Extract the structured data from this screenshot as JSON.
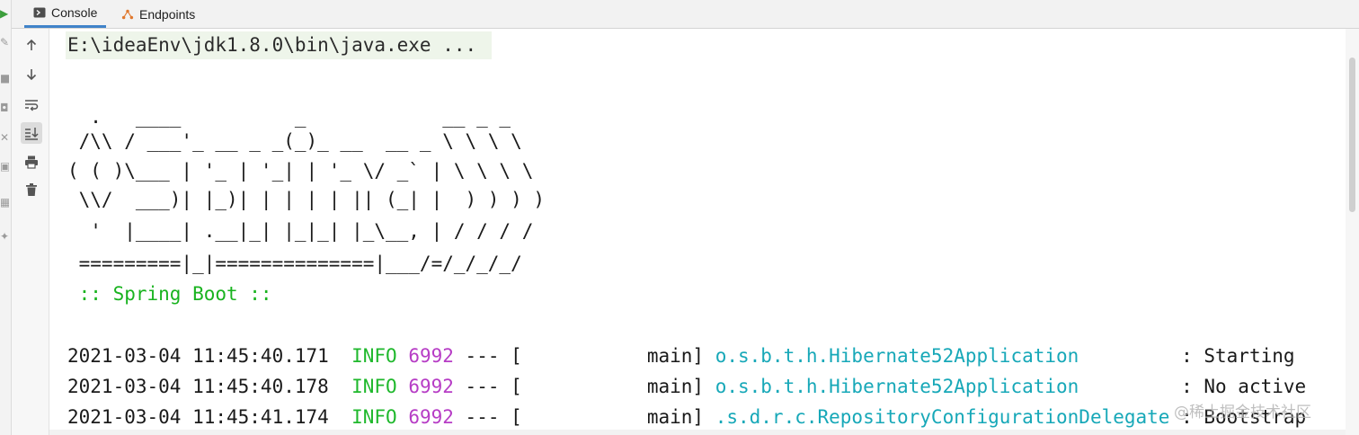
{
  "tabs": [
    {
      "label": "Console",
      "icon": "console-icon",
      "active": true
    },
    {
      "label": "Endpoints",
      "icon": "endpoints-icon",
      "active": false
    }
  ],
  "toolbar": {
    "buttons": [
      "up-arrow-icon",
      "down-arrow-icon",
      "soft-wrap-icon",
      "scroll-to-end-icon",
      "print-icon",
      "trash-icon"
    ]
  },
  "console": {
    "command": "E:\\ideaEnv\\jdk1.8.0\\bin\\java.exe ...",
    "banner": [
      "  .   ____          _            __ _ _",
      " /\\\\ / ___'_ __ _ _(_)_ __  __ _ \\ \\ \\ \\",
      "( ( )\\___ | '_ | '_| | '_ \\/ _` | \\ \\ \\ \\",
      " \\\\/  ___)| |_)| | | | | || (_| |  ) ) ) )",
      "  '  |____| .__|_| |_|_| |_\\__, | / / / /",
      " =========|_|==============|___/=/_/_/_/"
    ],
    "spring_label": " :: Spring Boot :: ",
    "logs": [
      {
        "timestamp": "2021-03-04 11:45:40.171",
        "level": "INFO",
        "pid": "6992",
        "sep": " --- [",
        "thread": "           main]",
        "logger": "o.s.b.t.h.Hibernate52Application",
        "message": "         : Starting"
      },
      {
        "timestamp": "2021-03-04 11:45:40.178",
        "level": "INFO",
        "pid": "6992",
        "sep": " --- [",
        "thread": "           main]",
        "logger": "o.s.b.t.h.Hibernate52Application",
        "message": "         : No active"
      },
      {
        "timestamp": "2021-03-04 11:45:41.174",
        "level": "INFO",
        "pid": "6992",
        "sep": " --- [",
        "thread": "           main]",
        "logger": ".s.d.r.c.RepositoryConfigurationDelegate",
        "message": " : Bootstrap"
      }
    ]
  },
  "watermark": "@稀土掘金技术社区",
  "colors": {
    "info": "#1fb82c",
    "pid": "#b63cc5",
    "logger": "#17a8b8",
    "tab_accent": "#4083c9"
  }
}
